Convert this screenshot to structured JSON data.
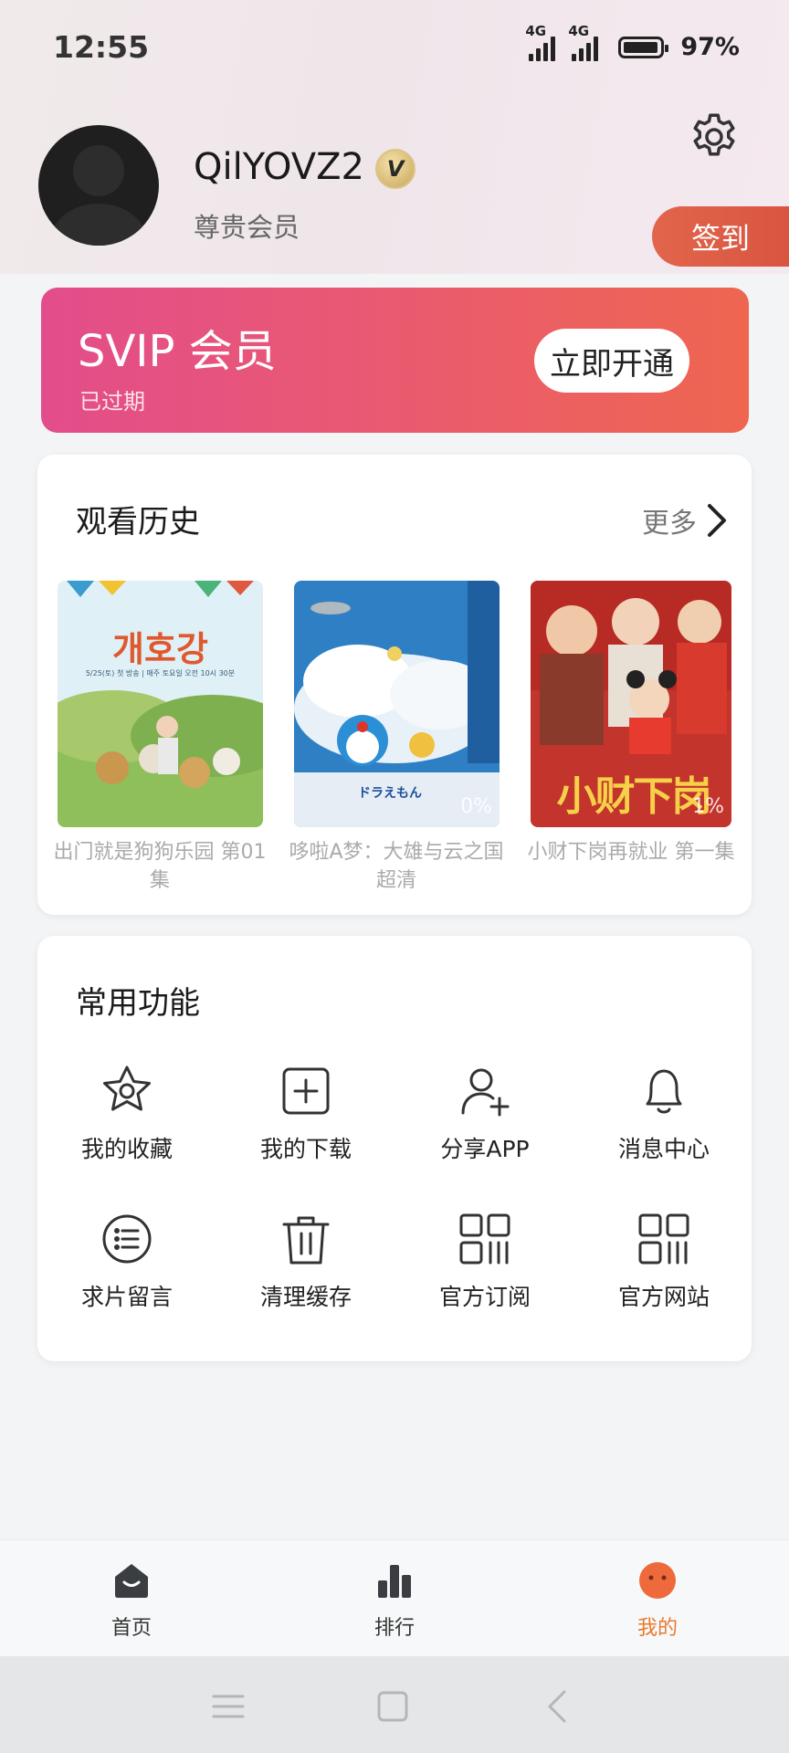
{
  "status_bar": {
    "time": "12:55",
    "net1": "4G",
    "net2": "4G",
    "battery": "97%"
  },
  "profile": {
    "username": "QilYOVZ2",
    "badge": "V",
    "member_label": "尊贵会员",
    "sign_in_label": "签到"
  },
  "svip": {
    "title": "SVIP 会员",
    "status": "已过期",
    "button_label": "立即开通"
  },
  "history": {
    "title": "观看历史",
    "more_label": "更多",
    "items": [
      {
        "caption": "出门就是狗狗乐园 第01集",
        "poster_text": "개호강",
        "poster_sub": "5/25(토) 첫 방송 | 매주 토요일 오전 10시 30분"
      },
      {
        "caption": "哆啦A梦：大雄与云之国 超清",
        "poster_text": "ドラえもん",
        "progress": "0%"
      },
      {
        "caption": "小财下岗再就业 第一集",
        "poster_text": "小财下岗",
        "progress": "1%"
      }
    ]
  },
  "functions": {
    "title": "常用功能",
    "items": [
      {
        "label": "我的收藏",
        "icon": "star-icon"
      },
      {
        "label": "我的下载",
        "icon": "download-icon"
      },
      {
        "label": "分享APP",
        "icon": "user-add-icon"
      },
      {
        "label": "消息中心",
        "icon": "bell-icon"
      },
      {
        "label": "求片留言",
        "icon": "list-icon"
      },
      {
        "label": "清理缓存",
        "icon": "trash-icon"
      },
      {
        "label": "官方订阅",
        "icon": "grid-icon"
      },
      {
        "label": "官方网站",
        "icon": "grid-icon"
      }
    ]
  },
  "tabs": [
    {
      "label": "首页",
      "icon": "home-icon"
    },
    {
      "label": "排行",
      "icon": "bar-chart-icon"
    },
    {
      "label": "我的",
      "icon": "face-icon",
      "active": true
    }
  ],
  "colors": {
    "accent": "#e87a2e",
    "svip_start": "#e34d8b",
    "svip_end": "#ee6650",
    "signin": "#e2654b"
  }
}
